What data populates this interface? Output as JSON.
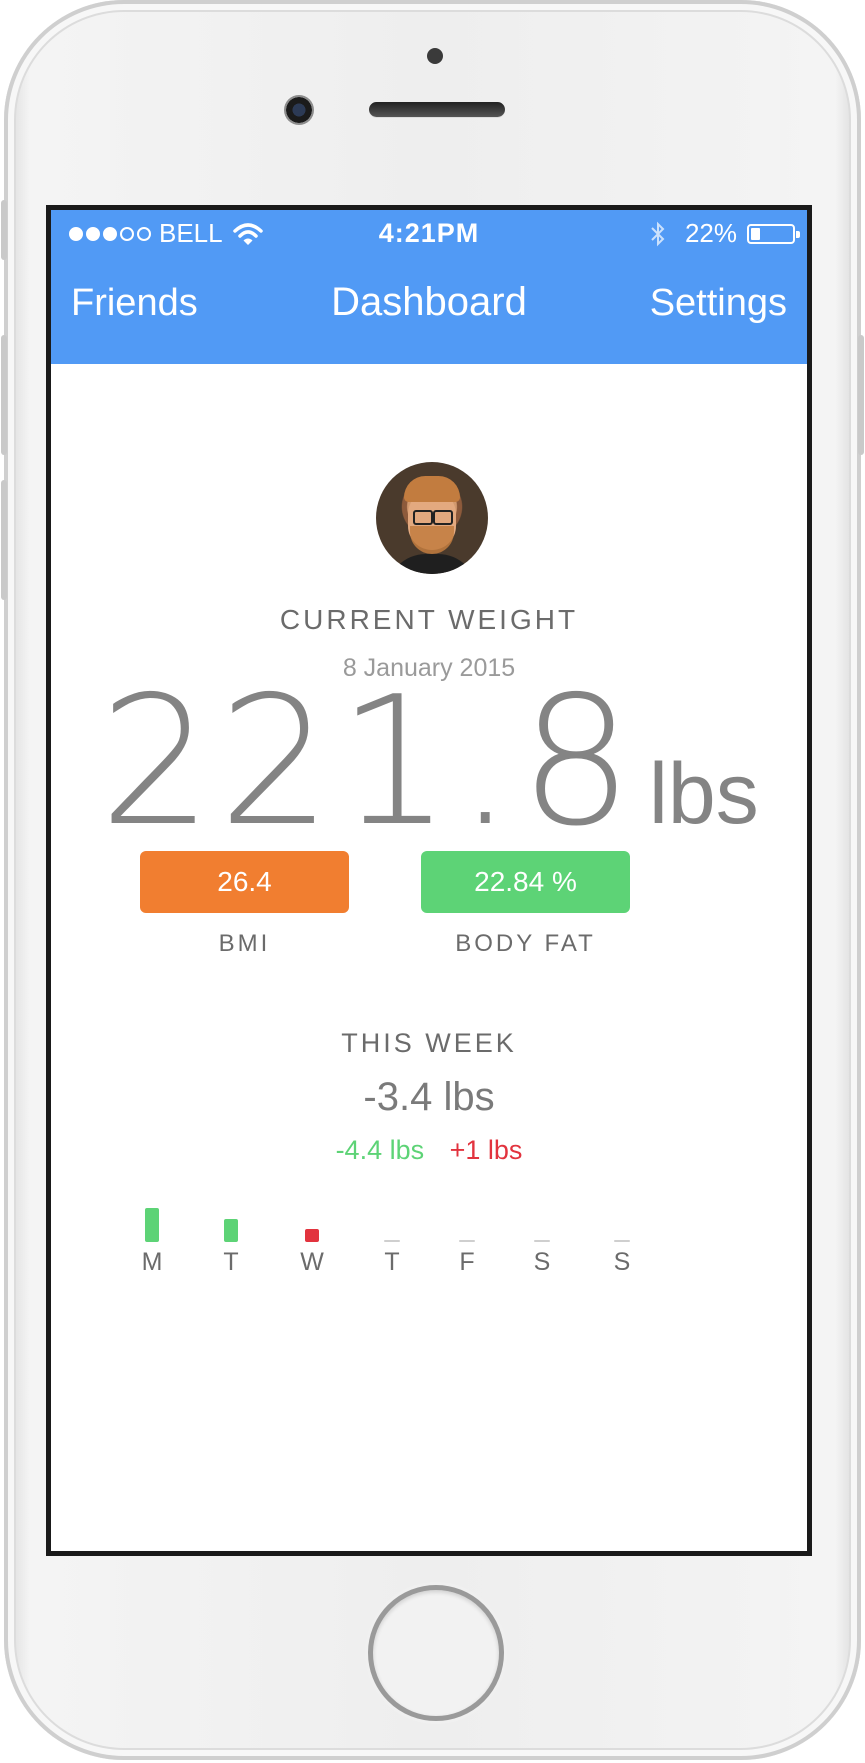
{
  "status_bar": {
    "carrier": "BELL",
    "signal_bars_filled": 3,
    "signal_bars_total": 5,
    "time": "4:21PM",
    "battery_percent": "22%"
  },
  "nav": {
    "left": "Friends",
    "title": "Dashboard",
    "right": "Settings"
  },
  "current_weight": {
    "label": "CURRENT WEIGHT",
    "date": "8 January 2015",
    "value": "221.8",
    "unit": "lbs"
  },
  "stats": {
    "bmi_value": "26.4",
    "bmi_label": "BMI",
    "body_fat_value": "22.84 %",
    "body_fat_label": "BODY FAT"
  },
  "this_week": {
    "label": "THIS WEEK",
    "net": "-3.4 lbs",
    "loss": "-4.4 lbs",
    "gain": "+1 lbs"
  },
  "week_days": [
    {
      "label": "M",
      "change": -2.6
    },
    {
      "label": "T",
      "change": -1.8
    },
    {
      "label": "W",
      "change": 1.0
    },
    {
      "label": "T",
      "change": 0
    },
    {
      "label": "F",
      "change": 0
    },
    {
      "label": "S",
      "change": 0
    },
    {
      "label": "S",
      "change": 0
    }
  ],
  "colors": {
    "primary": "#519af5",
    "bmi": "#f17e30",
    "body_fat": "#5dd376",
    "loss": "#5dd376",
    "gain": "#e2333e"
  }
}
